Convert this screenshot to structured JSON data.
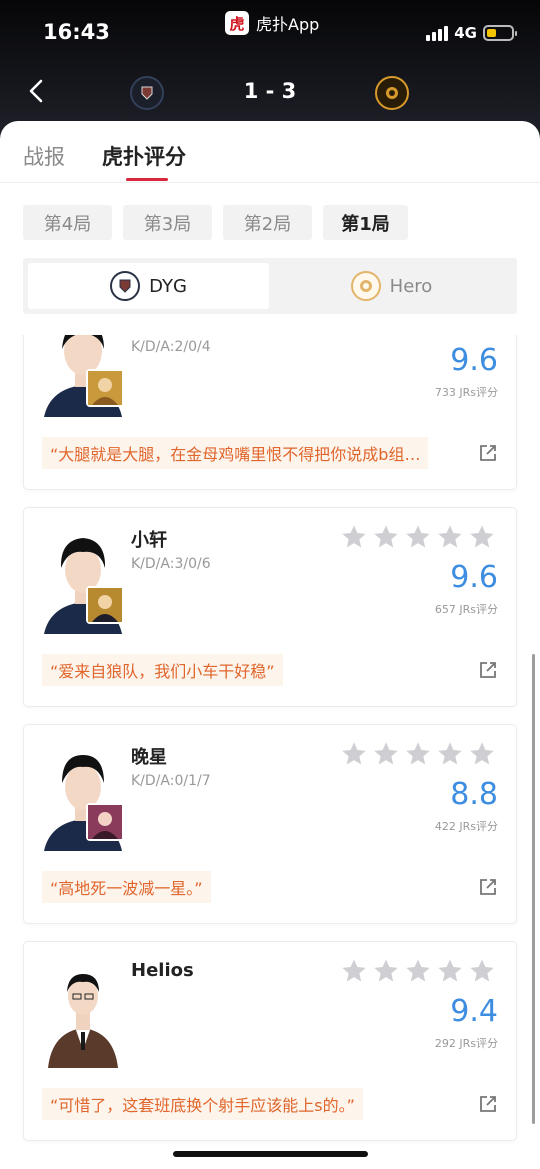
{
  "status_bar": {
    "time": "16:43",
    "network": "4G",
    "battery_level": 0.3
  },
  "app": {
    "logo_char": "虎",
    "name": "虎扑App"
  },
  "match": {
    "score": "1 - 3",
    "home_team_icon": "dyg-logo-icon",
    "away_team_icon": "hero-logo-icon"
  },
  "tabs": [
    {
      "label": "战报",
      "active": false
    },
    {
      "label": "虎扑评分",
      "active": true
    }
  ],
  "game_tabs": [
    {
      "label": "第4局",
      "active": false
    },
    {
      "label": "第3局",
      "active": false
    },
    {
      "label": "第2局",
      "active": false
    },
    {
      "label": "第1局",
      "active": true
    }
  ],
  "teams": [
    {
      "label": "DYG",
      "active": true
    },
    {
      "label": "Hero",
      "active": false
    }
  ],
  "players": [
    {
      "name": "",
      "kda": "K/D/A:2/0/4",
      "score": "9.6",
      "ratings": "733 JRs评分",
      "comment": "“大腿就是大腿，在金母鸡嘴里恨不得把你说成b组…",
      "hero_color": "#c89a3c"
    },
    {
      "name": "小轩",
      "kda": "K/D/A:3/0/6",
      "score": "9.6",
      "ratings": "657 JRs评分",
      "comment": "“爱来自狼队，我们小车干好稳”",
      "hero_color": "#b88a30"
    },
    {
      "name": "晚星",
      "kda": "K/D/A:0/1/7",
      "score": "8.8",
      "ratings": "422 JRs评分",
      "comment": "“高地死一波减一星。”",
      "hero_color": "#8a3a5a"
    },
    {
      "name": "Helios",
      "kda": "",
      "score": "9.4",
      "ratings": "292 JRs评分",
      "comment": "“可惜了，这套班底换个射手应该能上s的。”",
      "hero_color": ""
    }
  ],
  "colors": {
    "accent": "#d7263d",
    "score_blue": "#3d8de0",
    "comment_orange": "#e0662c"
  }
}
